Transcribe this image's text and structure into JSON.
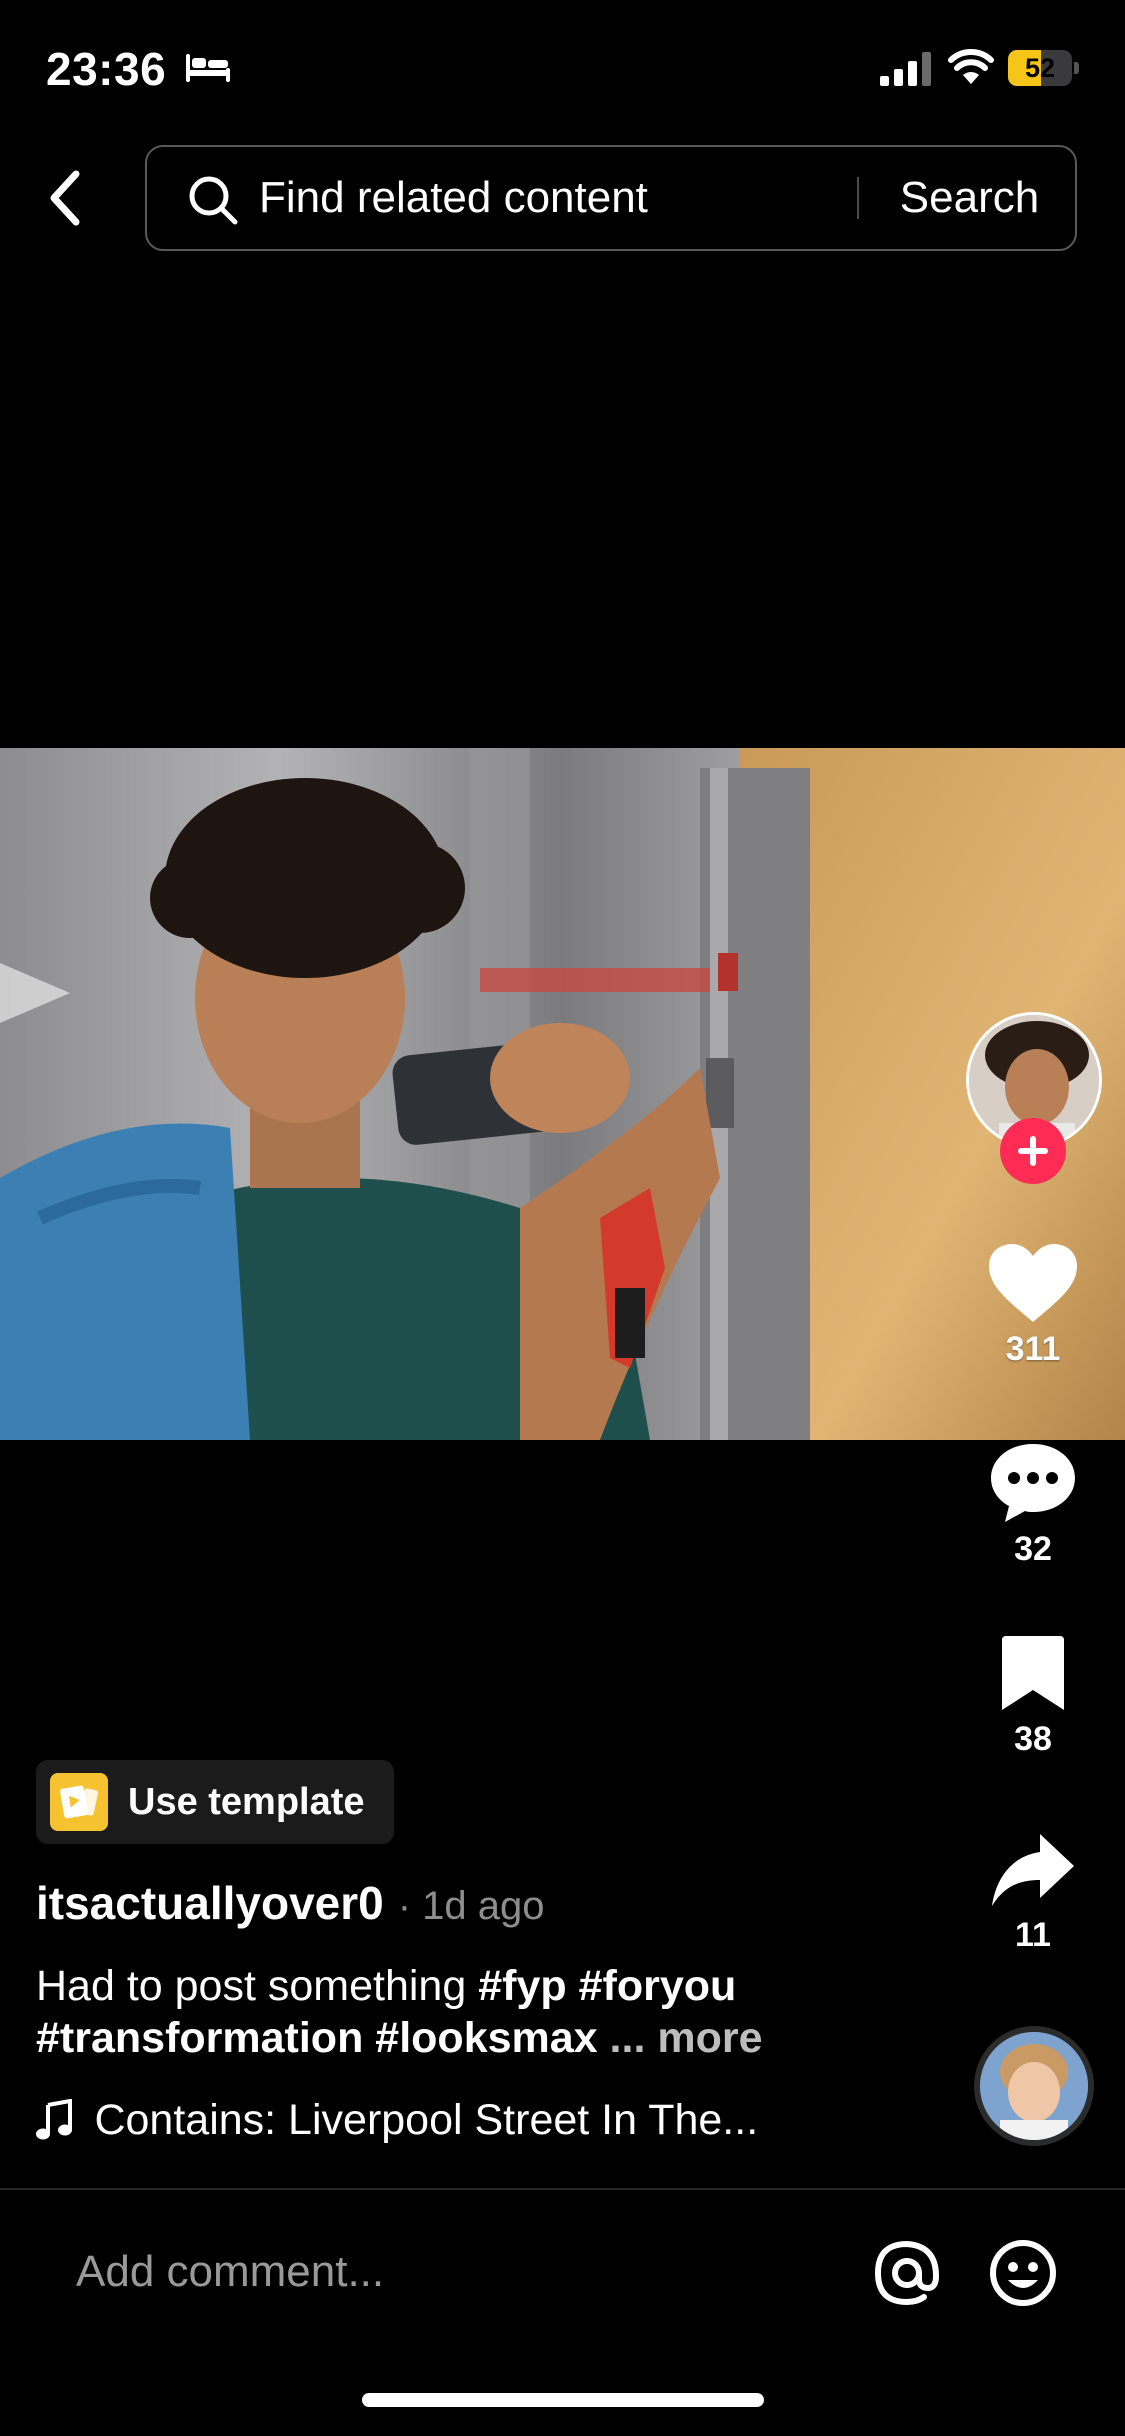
{
  "status_bar": {
    "time": "23:36",
    "battery_level": "52",
    "battery_fraction": 0.52,
    "icons": [
      "bed-icon",
      "cellular-signal-icon",
      "wifi-icon",
      "battery-icon"
    ]
  },
  "header": {
    "back_icon": "chevron-left-icon",
    "search_placeholder": "Find related content",
    "search_button_label": "Search"
  },
  "video": {
    "description_visible": "mirror selfie video frame"
  },
  "side_actions": {
    "creator_avatar": "creator-avatar",
    "follow_icon": "plus-icon",
    "like_count": "311",
    "comment_count": "32",
    "bookmark_count": "38",
    "share_count": "11",
    "sound_disc": "sound-disc"
  },
  "template": {
    "label": "Use template"
  },
  "post": {
    "author": "itsactuallyover0",
    "time_ago": "· 1d ago",
    "caption_text": "Had to post something",
    "hashtags": [
      "#fyp",
      "#foryou",
      "#transformation",
      "#looksmax"
    ],
    "ellipsis": "...",
    "more_label": "more",
    "music": "Contains: Liverpool Street In The..."
  },
  "comment_bar": {
    "placeholder": "Add comment...",
    "mention_icon": "at-icon",
    "emoji_icon": "emoji-icon"
  },
  "colors": {
    "background": "#000000",
    "follow_red": "#fe2c55",
    "template_yellow": "#f7c230",
    "battery_yellow": "#f5c518",
    "muted_text": "#8e8e8e"
  }
}
